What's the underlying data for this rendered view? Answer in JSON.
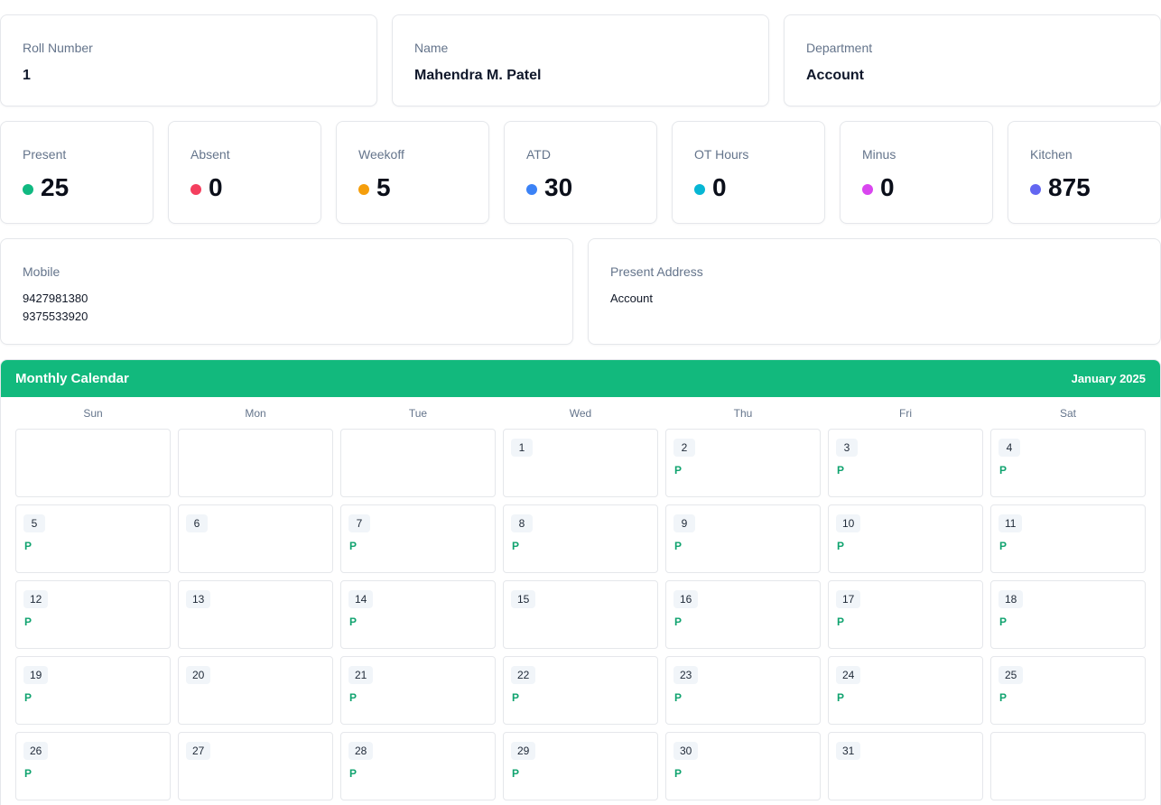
{
  "info": [
    {
      "label": "Roll Number",
      "value": "1"
    },
    {
      "label": "Name",
      "value": "Mahendra M. Patel"
    },
    {
      "label": "Department",
      "value": "Account"
    }
  ],
  "stats": [
    {
      "label": "Present",
      "value": "25",
      "color": "#10b981"
    },
    {
      "label": "Absent",
      "value": "0",
      "color": "#f43f5e"
    },
    {
      "label": "Weekoff",
      "value": "5",
      "color": "#f59e0b"
    },
    {
      "label": "ATD",
      "value": "30",
      "color": "#3b82f6"
    },
    {
      "label": "OT Hours",
      "value": "0",
      "color": "#06b6d4"
    },
    {
      "label": "Minus",
      "value": "0",
      "color": "#d946ef"
    },
    {
      "label": "Kitchen",
      "value": "875",
      "color": "#6366f1"
    }
  ],
  "mobile": {
    "label": "Mobile",
    "numbers": [
      "9427981380",
      "9375533920"
    ]
  },
  "address": {
    "label": "Present Address",
    "value": "Account"
  },
  "calendar": {
    "title": "Monthly Calendar",
    "month": "January 2025",
    "accent": "#12b97d",
    "weekdays": [
      "Sun",
      "Mon",
      "Tue",
      "Wed",
      "Thu",
      "Fri",
      "Sat"
    ],
    "cells": [
      {
        "day": "",
        "status": ""
      },
      {
        "day": "",
        "status": ""
      },
      {
        "day": "",
        "status": ""
      },
      {
        "day": "1",
        "status": ""
      },
      {
        "day": "2",
        "status": "P"
      },
      {
        "day": "3",
        "status": "P"
      },
      {
        "day": "4",
        "status": "P"
      },
      {
        "day": "5",
        "status": "P"
      },
      {
        "day": "6",
        "status": ""
      },
      {
        "day": "7",
        "status": "P"
      },
      {
        "day": "8",
        "status": "P"
      },
      {
        "day": "9",
        "status": "P"
      },
      {
        "day": "10",
        "status": "P"
      },
      {
        "day": "11",
        "status": "P"
      },
      {
        "day": "12",
        "status": "P"
      },
      {
        "day": "13",
        "status": ""
      },
      {
        "day": "14",
        "status": "P"
      },
      {
        "day": "15",
        "status": ""
      },
      {
        "day": "16",
        "status": "P"
      },
      {
        "day": "17",
        "status": "P"
      },
      {
        "day": "18",
        "status": "P"
      },
      {
        "day": "19",
        "status": "P"
      },
      {
        "day": "20",
        "status": ""
      },
      {
        "day": "21",
        "status": "P"
      },
      {
        "day": "22",
        "status": "P"
      },
      {
        "day": "23",
        "status": "P"
      },
      {
        "day": "24",
        "status": "P"
      },
      {
        "day": "25",
        "status": "P"
      },
      {
        "day": "26",
        "status": "P"
      },
      {
        "day": "27",
        "status": ""
      },
      {
        "day": "28",
        "status": "P"
      },
      {
        "day": "29",
        "status": "P"
      },
      {
        "day": "30",
        "status": "P"
      },
      {
        "day": "31",
        "status": ""
      },
      {
        "day": "",
        "status": ""
      }
    ]
  }
}
